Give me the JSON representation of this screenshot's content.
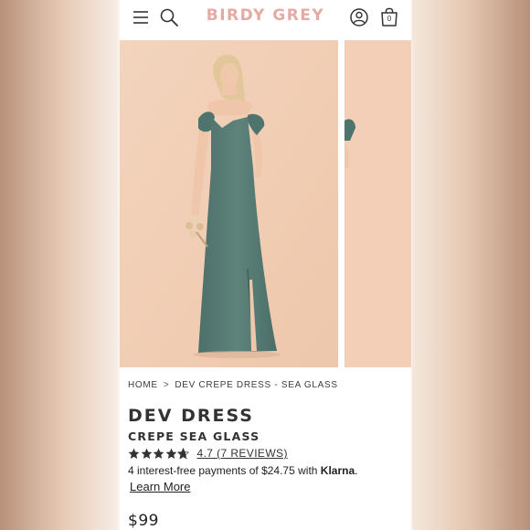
{
  "header": {
    "brand": "BIRDY GREY",
    "bag_count": "0",
    "icons": {
      "menu": "hamburger-menu-icon",
      "search": "search-icon",
      "account": "account-icon",
      "bag": "shopping-bag-icon"
    },
    "brand_color": "#e4aaa3"
  },
  "breadcrumb": {
    "home": "HOME",
    "separator": ">",
    "current": "DEV CREPE DRESS - SEA GLASS"
  },
  "product": {
    "name": "DEV DRESS",
    "variant": "CREPE SEA GLASS",
    "rating": {
      "stars": 4.7,
      "label": "4.7 (7 REVIEWS)"
    },
    "klarna": {
      "text": "4 interest-free payments of $24.75 with",
      "brand": "Klarna",
      "suffix": ".",
      "learn_more": "Learn More"
    },
    "price": "$99"
  },
  "gallery": {
    "dress_color": "#587d76",
    "background_color": "#f2cfb6"
  }
}
